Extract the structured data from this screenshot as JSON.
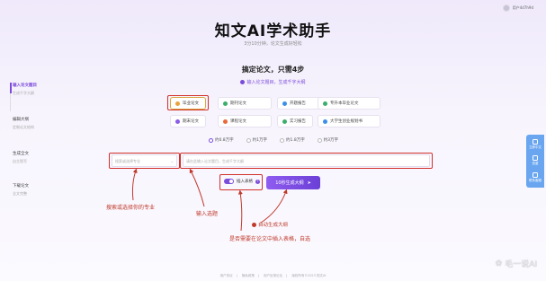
{
  "header": {
    "user_name": "用户4d7h9d",
    "title": "知文AI学术助手",
    "subtitle": "3分10分钟，论文生成好轻松",
    "steps_title": "搞定论文，只需4步",
    "step_hint": "输入论文题目，生成千字大纲"
  },
  "sidebar": {
    "steps": [
      {
        "name": "输入论文题目",
        "desc": "生成千字大纲"
      },
      {
        "name": "编辑大纲",
        "desc": "定制论文结构"
      },
      {
        "name": "生成全文",
        "desc": "自主智写"
      },
      {
        "name": "下载论文",
        "desc": "全文完整"
      }
    ]
  },
  "paper_types": [
    {
      "label": "毕业论文",
      "color": "#e8a33b"
    },
    {
      "label": "期刊论文",
      "color": "#3cae6b"
    },
    {
      "label": "开题报告",
      "color": "#3b8fe8"
    },
    {
      "label": "专升本毕业论文",
      "color": "#3cae6b"
    },
    {
      "label": "期末论文",
      "color": "#8a5ce8"
    },
    {
      "label": "课程论文",
      "color": "#e86a3b"
    },
    {
      "label": "实习报告",
      "color": "#3cae6b"
    },
    {
      "label": "大学生创业规划书",
      "color": "#3b8fe8"
    }
  ],
  "word_counts": [
    "约0.8万字",
    "约1万字",
    "约1.8万字",
    "约3万字"
  ],
  "inputs": {
    "major_placeholder": "搜索或选择专业",
    "title_placeholder": "请在此输入论文题目，生成千字大纲"
  },
  "toggle_label": "插入表格",
  "generate_button": "10秒生成大纲",
  "annotations": {
    "major": "搜索或选择你的专业",
    "title": "输入选题",
    "auto": "自动生成大纲",
    "table": "是否需要在论文中插入表格，自选"
  },
  "footer": [
    "用户协议",
    "隐私政策",
    "用户反馈论坛",
    "版权所有©2023 知文AI"
  ],
  "watermark": "毛一说AI",
  "float_bar": [
    "立即中文",
    "查重",
    "联系客服"
  ],
  "colors": {
    "accent": "#7b4bdb",
    "annotation": "#c0392b",
    "float": "#6aa6f0"
  }
}
